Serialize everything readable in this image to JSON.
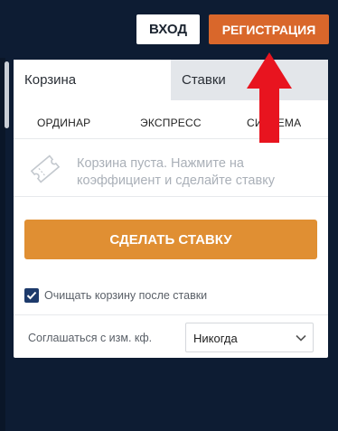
{
  "header": {
    "login_label": "ВХОД",
    "register_label": "РЕГИСТРАЦИЯ"
  },
  "coupon": {
    "tabs": [
      {
        "label": "Корзина",
        "active": true
      },
      {
        "label": "Ставки",
        "active": false
      }
    ],
    "bet_types": [
      "ОРДИНАР",
      "ЭКСПРЕСС",
      "СИСТЕМА"
    ],
    "empty_message": "Корзина пуста. Нажмите на коэффициент и сделайте ставку",
    "make_bet_label": "СДЕЛАТЬ СТАВКУ",
    "clear_after_bet": {
      "label": "Очищать корзину после ставки",
      "checked": true
    },
    "odds_change": {
      "label": "Соглашаться с изм. кф.",
      "selected": "Никогда"
    }
  },
  "icons": {
    "ticket": "ticket-icon",
    "arrow": "red-up-arrow-annotation",
    "check": "check-icon",
    "chevron": "chevron-down-icon"
  },
  "colors": {
    "background": "#0d1c33",
    "register": "#d9672b",
    "make_bet": "#e08f33",
    "arrow": "#e8141f",
    "checkbox": "#1d3a6b"
  }
}
